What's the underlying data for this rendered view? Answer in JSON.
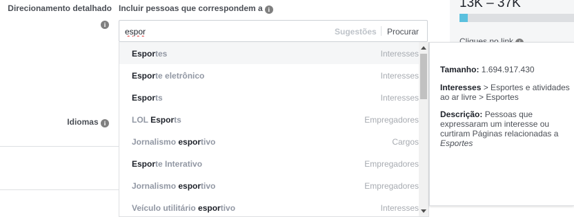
{
  "left": {
    "detailed_targeting_label": "Direcionamento detalhado",
    "languages_label": "Idiomas"
  },
  "include": {
    "label": "Incluir pessoas que correspondem a"
  },
  "search": {
    "value": "espor",
    "suggestions_label": "Sugestões",
    "browse_label": "Procurar"
  },
  "results": [
    {
      "match": "Espor",
      "rest": "tes",
      "pre": "",
      "type": "Interesses"
    },
    {
      "match": "Espor",
      "rest": "te eletrônico",
      "pre": "",
      "type": "Interesses"
    },
    {
      "match": "Espor",
      "rest": "ts",
      "pre": "",
      "type": "Interesses"
    },
    {
      "pre": "LOL ",
      "match": "Espor",
      "rest": "ts",
      "type": "Empregadores"
    },
    {
      "pre": "Jornalismo ",
      "match": "espor",
      "rest": "tivo",
      "type": "Cargos"
    },
    {
      "match": "Espor",
      "rest": "te Interativo",
      "pre": "",
      "type": "Empregadores"
    },
    {
      "pre": "Jornalismo ",
      "match": "espor",
      "rest": "tivo",
      "type": "Empregadores"
    },
    {
      "pre": "Veículo utilitário ",
      "match": "espor",
      "rest": "tivo",
      "type": "Interesses"
    }
  ],
  "scrollbar": {
    "thumb_fraction": 0.29
  },
  "detail": {
    "size_label": "Tamanho:",
    "size_value": "1.694.917.430",
    "interests_label": "Interesses",
    "interests_path": "> Esportes e atividades ao ar livre > Esportes",
    "description_label": "Descrição:",
    "description_text": "Pessoas que expressaram um interesse ou curtiram Páginas relacionadas a",
    "description_topic": "Esportes"
  },
  "reach": {
    "range_text": "13K – 37K",
    "bar_fraction": 0.07,
    "clicks_label": "Cliques no link"
  },
  "colors": {
    "accent": "#5bc0de",
    "match_text": "#1d2129",
    "rest_text": "#9197a3"
  }
}
